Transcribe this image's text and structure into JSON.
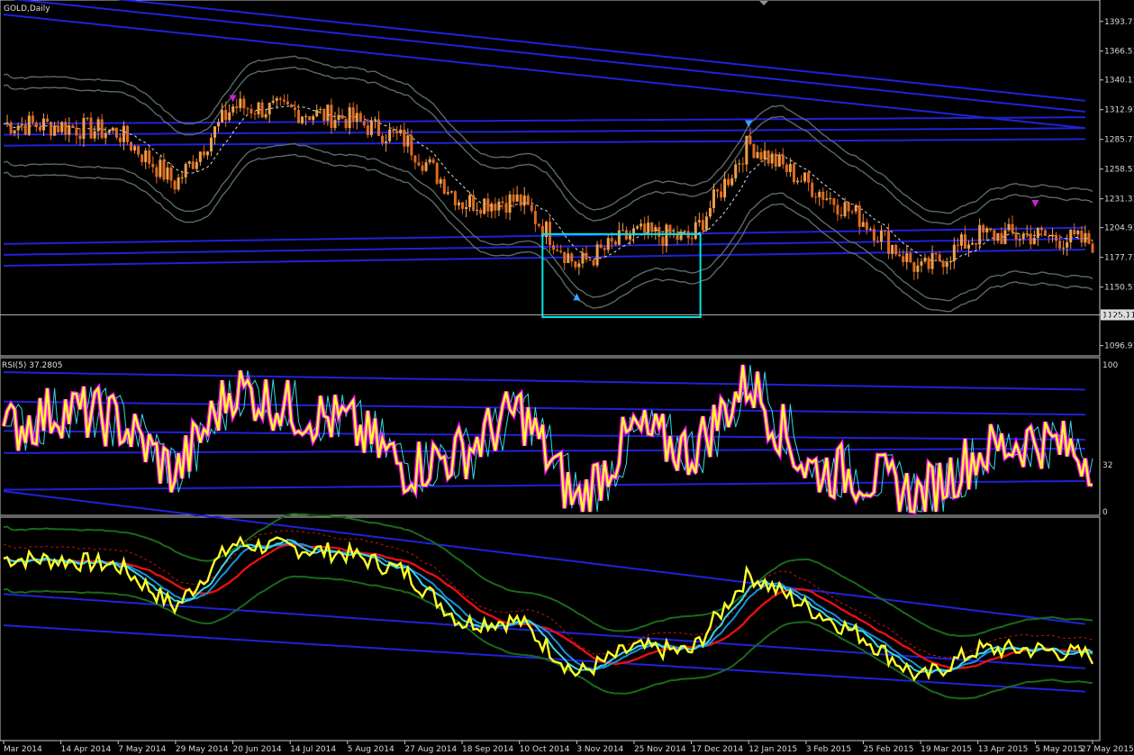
{
  "window": {
    "title": "GOLD,Daily"
  },
  "indicator_label": "RSI(5) 37.2805",
  "colors": {
    "background": "#000000",
    "frame": "#c8c8c8",
    "bull": "#f0a04a",
    "bear": "#e06a20",
    "blue_band": "#2121d9",
    "gray_band": "#5a6a66",
    "ma_dash": "#e0e0e0",
    "selection_box": "#00e5e5",
    "rsi_fast": "#ffff28",
    "rsi_glow": "#ff10ff",
    "rsi_signal": "#3ad6e6",
    "red_line": "#e61010",
    "green_band": "#1a6a1a"
  },
  "price_axis": {
    "ticks": [
      "1393.71",
      "1366.51",
      "1340.11",
      "1312.91",
      "1285.71",
      "1258.51",
      "1231.31",
      "1204.91",
      "1177.71",
      "1150.51",
      "1125.11",
      "1096.91"
    ],
    "current_price": "1125.11"
  },
  "rsi_axis": {
    "ticks": [
      "100",
      "32",
      "0"
    ]
  },
  "time_axis": {
    "labels": [
      "Mar 2014",
      "14 Apr 2014",
      "7 May 2014",
      "29 May 2014",
      "20 Jun 2014",
      "14 Jul 2014",
      "5 Aug 2014",
      "27 Aug 2014",
      "18 Sep 2014",
      "10 Oct 2014",
      "3 Nov 2014",
      "25 Nov 2014",
      "17 Dec 2014",
      "12 Jan 2015",
      "3 Feb 2015",
      "25 Feb 2015",
      "19 Mar 2015",
      "13 Apr 2015",
      "5 May 2015",
      "27 May 2015"
    ]
  },
  "markers": [
    {
      "date": "20 Jun 2014",
      "price": 1318,
      "type": "down-arrow",
      "color": "#d020d0"
    },
    {
      "date": "3 Nov 2014",
      "price": 1140,
      "type": "up-arrow",
      "color": "#3aa0ff"
    },
    {
      "date": "12 Jan 2015",
      "price": 1295,
      "type": "down-arrow",
      "color": "#3aa0ff"
    },
    {
      "date": "5 May 2015",
      "price": 1222,
      "type": "down-arrow",
      "color": "#d020d0"
    }
  ],
  "chart_data": {
    "type": "line",
    "symbol": "GOLD",
    "timeframe": "Daily",
    "x": [
      "Mar 2014",
      "14 Apr 2014",
      "7 May 2014",
      "29 May 2014",
      "20 Jun 2014",
      "14 Jul 2014",
      "5 Aug 2014",
      "27 Aug 2014",
      "18 Sep 2014",
      "10 Oct 2014",
      "3 Nov 2014",
      "25 Nov 2014",
      "17 Dec 2014",
      "12 Jan 2015",
      "3 Feb 2015",
      "25 Feb 2015",
      "19 Mar 2015",
      "13 Apr 2015",
      "5 May 2015",
      "27 May 2015"
    ],
    "price_close": [
      1300,
      1298,
      1292,
      1245,
      1316,
      1312,
      1305,
      1285,
      1228,
      1230,
      1170,
      1200,
      1195,
      1282,
      1246,
      1212,
      1165,
      1198,
      1198,
      1191
    ],
    "ylim": [
      1090,
      1410
    ],
    "rsi": [
      55,
      70,
      62,
      25,
      85,
      70,
      60,
      30,
      40,
      70,
      5,
      55,
      40,
      90,
      30,
      25,
      10,
      40,
      50,
      37
    ],
    "rsi_ylim": [
      0,
      100
    ],
    "selection_box": {
      "from": "3 Nov 2014",
      "to": "17 Dec 2014",
      "price_low": 1123,
      "price_high": 1199
    }
  }
}
